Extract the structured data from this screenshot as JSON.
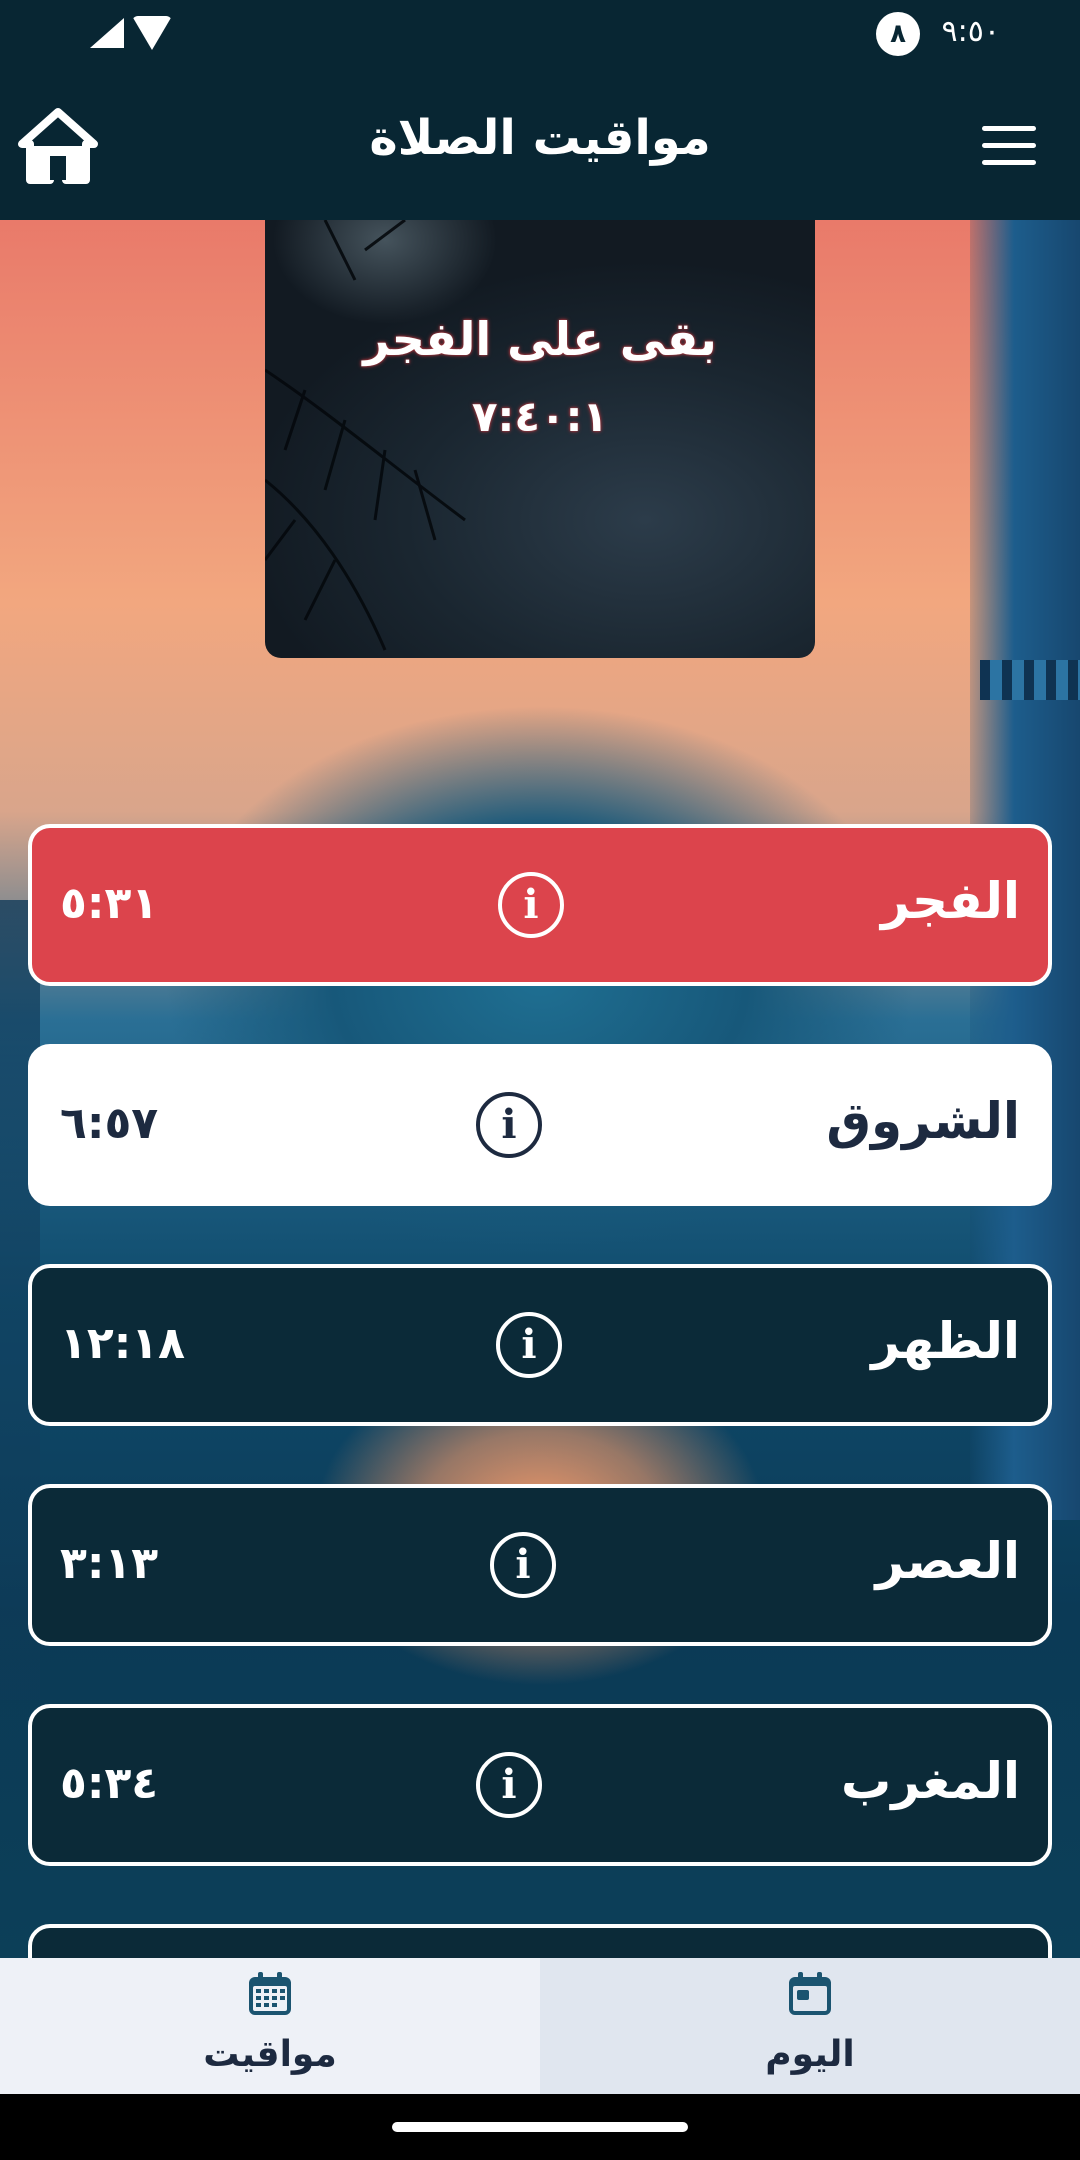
{
  "status_bar": {
    "time": "٩:٥٠",
    "notification_count": "٨"
  },
  "app_bar": {
    "title": "مواقيت الصلاة"
  },
  "countdown": {
    "label": "بقى على الفجر",
    "timer": "٧:٤٠:١"
  },
  "prayers": [
    {
      "name": "الفجر",
      "time": "٥:٣١"
    },
    {
      "name": "الشروق",
      "time": "٦:٥٧"
    },
    {
      "name": "الظهر",
      "time": "١٢:١٨"
    },
    {
      "name": "العصر",
      "time": "٣:١٣"
    },
    {
      "name": "المغرب",
      "time": "٥:٣٤"
    }
  ],
  "bottom_nav": {
    "times_label": "مواقيت",
    "today_label": "اليوم"
  },
  "colors": {
    "app_bar": "#082633",
    "active_prayer": "#dc444c",
    "card_dark": "#0b2a38",
    "nav_icon": "#1b5470"
  }
}
